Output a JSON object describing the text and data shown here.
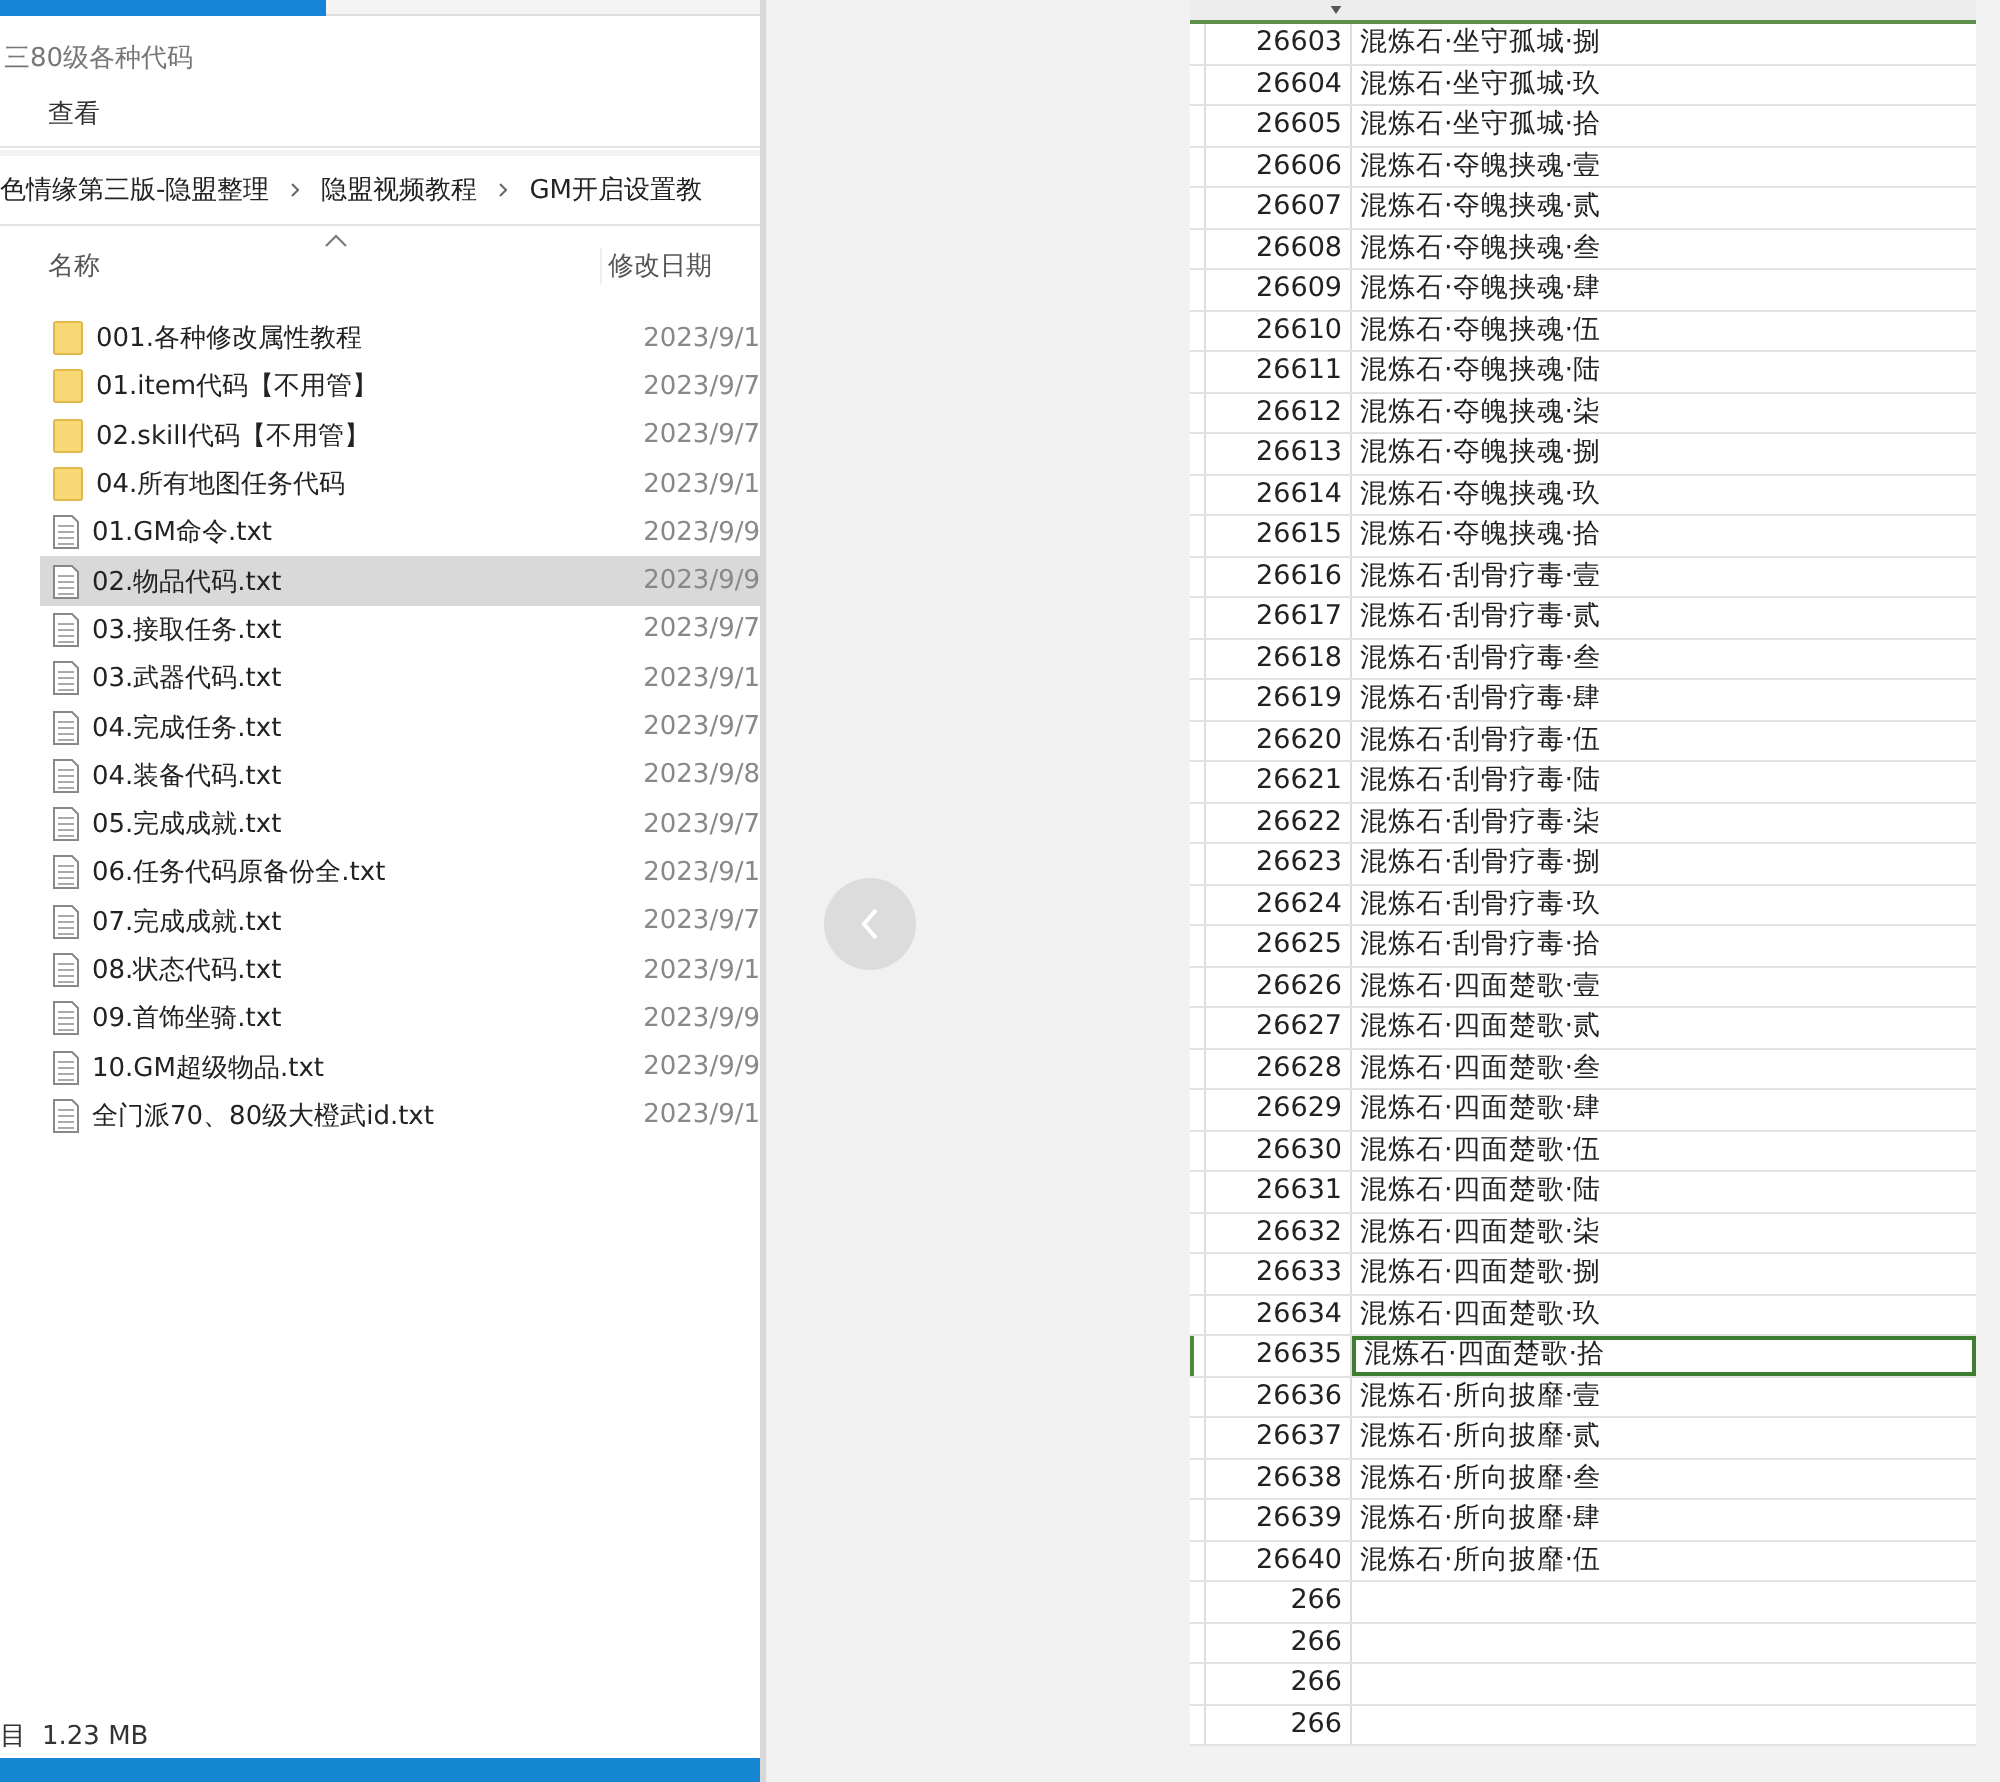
{
  "explorer": {
    "title": "三80级各种代码",
    "ribbon": [
      "查看"
    ],
    "breadcrumb": [
      "色情缘第三版-隐盟整理",
      "隐盟视频教程",
      "GM开启设置教"
    ],
    "columns": [
      "名称",
      "修改日期"
    ],
    "files": [
      {
        "kind": "folder",
        "name": "001.各种修改属性教程",
        "date": "2023/9/1",
        "selected": false
      },
      {
        "kind": "folder",
        "name": "01.item代码【不用管】",
        "date": "2023/9/7",
        "selected": false
      },
      {
        "kind": "folder",
        "name": "02.skill代码【不用管】",
        "date": "2023/9/7",
        "selected": false
      },
      {
        "kind": "folder",
        "name": "04.所有地图任务代码",
        "date": "2023/9/1",
        "selected": false
      },
      {
        "kind": "file",
        "name": "01.GM命令.txt",
        "date": "2023/9/9",
        "selected": false
      },
      {
        "kind": "file",
        "name": "02.物品代码.txt",
        "date": "2023/9/9",
        "selected": true
      },
      {
        "kind": "file",
        "name": "03.接取任务.txt",
        "date": "2023/9/7",
        "selected": false
      },
      {
        "kind": "file",
        "name": "03.武器代码.txt",
        "date": "2023/9/1",
        "selected": false
      },
      {
        "kind": "file",
        "name": "04.完成任务.txt",
        "date": "2023/9/7",
        "selected": false
      },
      {
        "kind": "file",
        "name": "04.装备代码.txt",
        "date": "2023/9/8",
        "selected": false
      },
      {
        "kind": "file",
        "name": "05.完成成就.txt",
        "date": "2023/9/7",
        "selected": false
      },
      {
        "kind": "file",
        "name": "06.任务代码原备份全.txt",
        "date": "2023/9/1",
        "selected": false
      },
      {
        "kind": "file",
        "name": "07.完成成就.txt",
        "date": "2023/9/7",
        "selected": false
      },
      {
        "kind": "file",
        "name": "08.状态代码.txt",
        "date": "2023/9/1",
        "selected": false
      },
      {
        "kind": "file",
        "name": "09.首饰坐骑.txt",
        "date": "2023/9/9",
        "selected": false
      },
      {
        "kind": "file",
        "name": "10.GM超级物品.txt",
        "date": "2023/9/9",
        "selected": false
      },
      {
        "kind": "file",
        "name": "全门派70、80级大橙武id.txt",
        "date": "2023/9/1",
        "selected": false
      }
    ],
    "status": [
      "目",
      "1.23 MB"
    ]
  },
  "sheet": {
    "rows": [
      {
        "id": "26603",
        "name": "混炼石·坐守孤城·捌",
        "selected": false
      },
      {
        "id": "26604",
        "name": "混炼石·坐守孤城·玖",
        "selected": false
      },
      {
        "id": "26605",
        "name": "混炼石·坐守孤城·拾",
        "selected": false
      },
      {
        "id": "26606",
        "name": "混炼石·夺魄挟魂·壹",
        "selected": false
      },
      {
        "id": "26607",
        "name": "混炼石·夺魄挟魂·贰",
        "selected": false
      },
      {
        "id": "26608",
        "name": "混炼石·夺魄挟魂·叁",
        "selected": false
      },
      {
        "id": "26609",
        "name": "混炼石·夺魄挟魂·肆",
        "selected": false
      },
      {
        "id": "26610",
        "name": "混炼石·夺魄挟魂·伍",
        "selected": false
      },
      {
        "id": "26611",
        "name": "混炼石·夺魄挟魂·陆",
        "selected": false
      },
      {
        "id": "26612",
        "name": "混炼石·夺魄挟魂·柒",
        "selected": false
      },
      {
        "id": "26613",
        "name": "混炼石·夺魄挟魂·捌",
        "selected": false
      },
      {
        "id": "26614",
        "name": "混炼石·夺魄挟魂·玖",
        "selected": false
      },
      {
        "id": "26615",
        "name": "混炼石·夺魄挟魂·拾",
        "selected": false
      },
      {
        "id": "26616",
        "name": "混炼石·刮骨疗毒·壹",
        "selected": false
      },
      {
        "id": "26617",
        "name": "混炼石·刮骨疗毒·贰",
        "selected": false
      },
      {
        "id": "26618",
        "name": "混炼石·刮骨疗毒·叁",
        "selected": false
      },
      {
        "id": "26619",
        "name": "混炼石·刮骨疗毒·肆",
        "selected": false
      },
      {
        "id": "26620",
        "name": "混炼石·刮骨疗毒·伍",
        "selected": false
      },
      {
        "id": "26621",
        "name": "混炼石·刮骨疗毒·陆",
        "selected": false
      },
      {
        "id": "26622",
        "name": "混炼石·刮骨疗毒·柒",
        "selected": false
      },
      {
        "id": "26623",
        "name": "混炼石·刮骨疗毒·捌",
        "selected": false
      },
      {
        "id": "26624",
        "name": "混炼石·刮骨疗毒·玖",
        "selected": false
      },
      {
        "id": "26625",
        "name": "混炼石·刮骨疗毒·拾",
        "selected": false
      },
      {
        "id": "26626",
        "name": "混炼石·四面楚歌·壹",
        "selected": false
      },
      {
        "id": "26627",
        "name": "混炼石·四面楚歌·贰",
        "selected": false
      },
      {
        "id": "26628",
        "name": "混炼石·四面楚歌·叁",
        "selected": false
      },
      {
        "id": "26629",
        "name": "混炼石·四面楚歌·肆",
        "selected": false
      },
      {
        "id": "26630",
        "name": "混炼石·四面楚歌·伍",
        "selected": false
      },
      {
        "id": "26631",
        "name": "混炼石·四面楚歌·陆",
        "selected": false
      },
      {
        "id": "26632",
        "name": "混炼石·四面楚歌·柒",
        "selected": false
      },
      {
        "id": "26633",
        "name": "混炼石·四面楚歌·捌",
        "selected": false
      },
      {
        "id": "26634",
        "name": "混炼石·四面楚歌·玖",
        "selected": false
      },
      {
        "id": "26635",
        "name": "混炼石·四面楚歌·拾",
        "selected": true
      },
      {
        "id": "26636",
        "name": "混炼石·所向披靡·壹",
        "selected": false
      },
      {
        "id": "26637",
        "name": "混炼石·所向披靡·贰",
        "selected": false
      },
      {
        "id": "26638",
        "name": "混炼石·所向披靡·叁",
        "selected": false
      },
      {
        "id": "26639",
        "name": "混炼石·所向披靡·肆",
        "selected": false
      },
      {
        "id": "26640",
        "name": "混炼石·所向披靡·伍",
        "selected": false
      },
      {
        "id": "266",
        "selected": false
      },
      {
        "id": "266",
        "selected": false
      },
      {
        "id": "266",
        "selected": false
      },
      {
        "id": "266",
        "selected": false
      }
    ]
  }
}
